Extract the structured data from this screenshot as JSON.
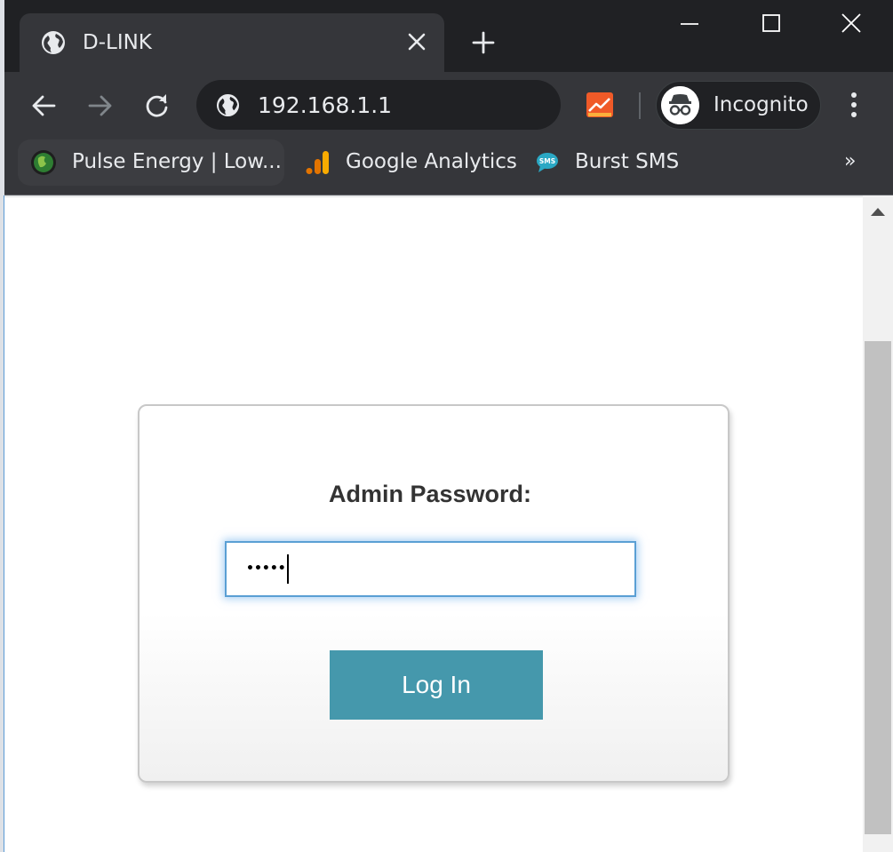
{
  "tab": {
    "title": "D-LINK"
  },
  "omnibox": {
    "url": "192.168.1.1"
  },
  "profile": {
    "label": "Incognito"
  },
  "bookmarks": {
    "items": [
      {
        "label": "Pulse Energy | Low...",
        "icon": "pulse-energy-favicon"
      },
      {
        "label": "Google Analytics",
        "icon": "google-analytics-favicon"
      },
      {
        "label": "Burst SMS",
        "icon": "burst-sms-favicon"
      }
    ],
    "overflow": "»"
  },
  "login": {
    "password_label": "Admin Password:",
    "password_value": "•••••",
    "button_label": "Log In"
  },
  "colors": {
    "chrome_dark": "#202124",
    "chrome_toolbar": "#35363a",
    "button": "#4598ac",
    "input_focus": "#5a9fd4"
  }
}
